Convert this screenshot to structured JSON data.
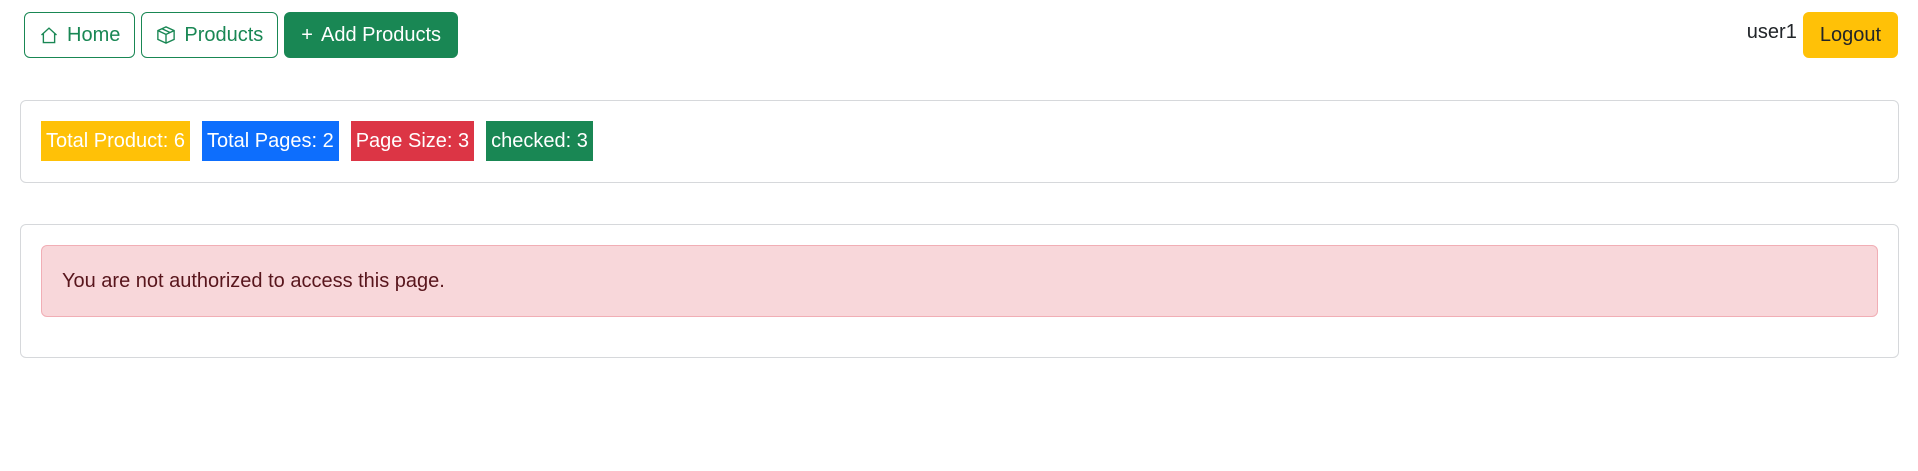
{
  "nav": {
    "home_label": "Home",
    "products_label": "Products",
    "add_products_label": "Add Products",
    "add_icon": "+",
    "user_name": "user1",
    "logout_label": "Logout"
  },
  "stats": {
    "total_product": "Total Product: 6",
    "total_pages": "Total Pages: 2",
    "page_size": "Page Size: 3",
    "checked": "checked: 3"
  },
  "alert": {
    "message": "You are not authorized to access this page."
  },
  "colors": {
    "success": "#198754",
    "warning": "#ffc107",
    "primary": "#0d6efd",
    "danger": "#dc3545",
    "alert_bg": "#f8d7da"
  },
  "icons": {
    "home": "house-icon",
    "products": "box-icon",
    "add": "plus-icon"
  }
}
